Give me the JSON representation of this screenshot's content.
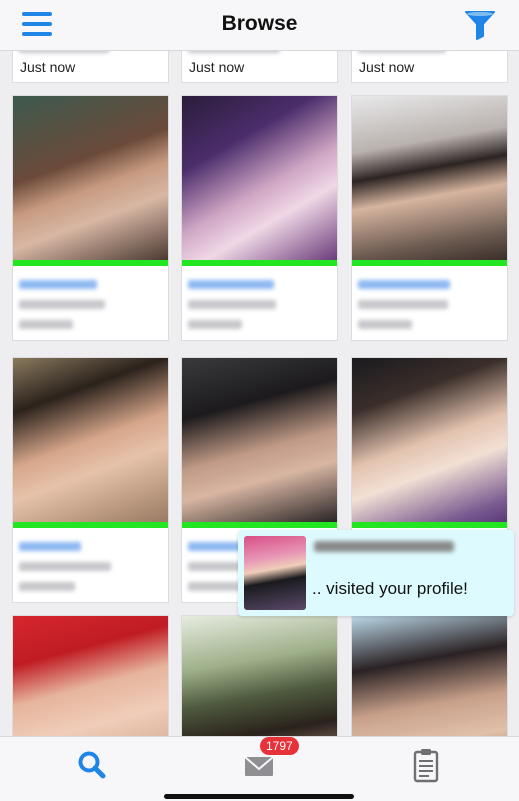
{
  "header": {
    "title": "Browse"
  },
  "top_row": {
    "time_label": "Just now"
  },
  "notification": {
    "message": ".. visited your profile!"
  },
  "tabbar": {
    "messages_badge": "1797"
  },
  "colors": {
    "accent": "#1f86e8",
    "online": "#22e622",
    "badge": "#e8323a",
    "toast_bg": "#ddfbff"
  }
}
